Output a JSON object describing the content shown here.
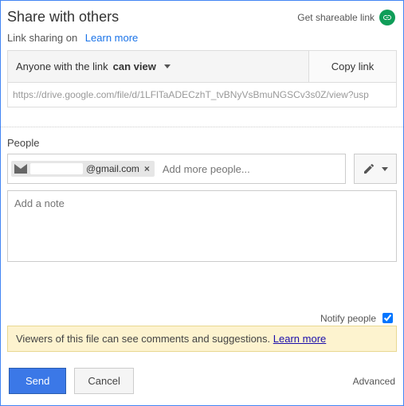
{
  "header": {
    "title": "Share with others",
    "shareable_link": "Get shareable link"
  },
  "link_sharing": {
    "status": "Link sharing on",
    "learn_more": "Learn more"
  },
  "permission": {
    "prefix": "Anyone with the link",
    "mode": "can view",
    "copy": "Copy link",
    "url": "https://drive.google.com/file/d/1LFlTaADECzhT_tvBNyVsBmuNGSCv3s0Z/view?usp"
  },
  "people": {
    "label": "People",
    "chip_suffix": "@gmail.com",
    "placeholder": "Add more people..."
  },
  "note": {
    "placeholder": "Add a note"
  },
  "notify": {
    "label": "Notify people",
    "checked": true
  },
  "banner": {
    "text": "Viewers of this file can see comments and suggestions.",
    "learn_more": "Learn more"
  },
  "footer": {
    "send": "Send",
    "cancel": "Cancel",
    "advanced": "Advanced"
  }
}
